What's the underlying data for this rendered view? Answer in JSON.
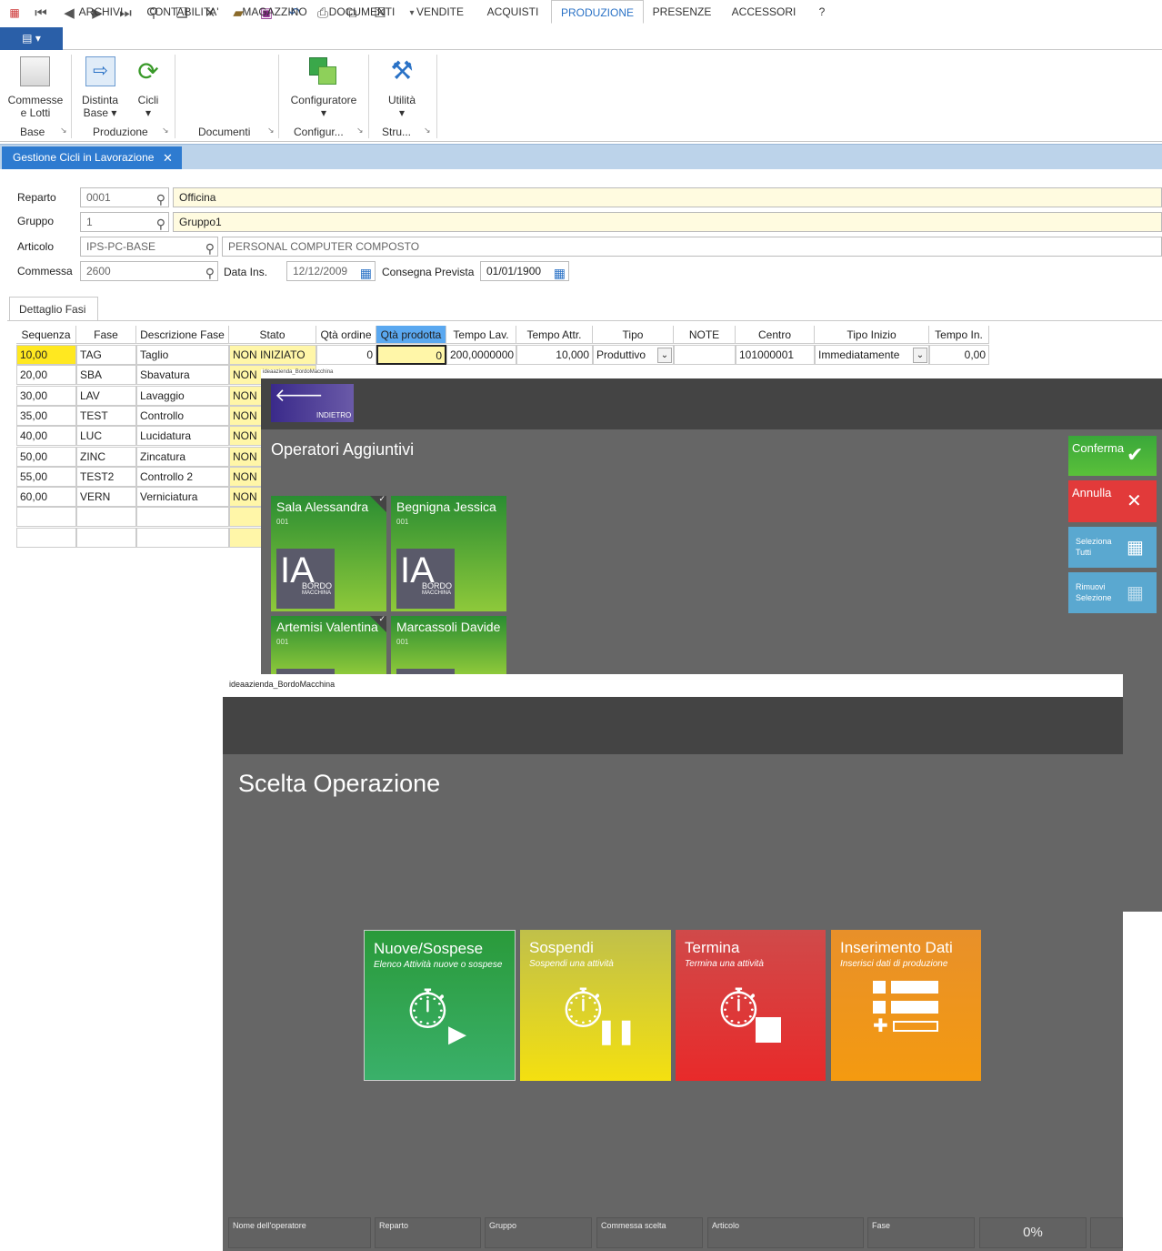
{
  "menu": {
    "file": "▤ ▾",
    "tabs": [
      "ARCHIVI",
      "CONTABILITA'",
      "MAGAZZINO",
      "DOCUMENTI",
      "VENDITE",
      "ACQUISTI",
      "PRODUZIONE",
      "PRESENZE",
      "ACCESSORI",
      "?"
    ],
    "active": "PRODUZIONE"
  },
  "ribbon": {
    "buttons": [
      "Commesse\ne Lotti",
      "Distinta\nBase ▾",
      "Cicli\n▾",
      "Configuratore\n▾",
      "Utilità\n▾"
    ],
    "groups": [
      "Base",
      "Produzione",
      "Documenti",
      "Configur...",
      "Stru..."
    ]
  },
  "doc_tab": {
    "label": "Gestione Cicli in Lavorazione",
    "close": "✕"
  },
  "form": {
    "reparto_label": "Reparto",
    "reparto_code": "0001",
    "reparto_desc": "Officina",
    "gruppo_label": "Gruppo",
    "gruppo_code": "1",
    "gruppo_desc": "Gruppo1",
    "articolo_label": "Articolo",
    "articolo_code": "IPS-PC-BASE",
    "articolo_desc": "PERSONAL COMPUTER COMPOSTO",
    "commessa_label": "Commessa",
    "commessa_code": "2600",
    "data_ins_label": "Data Ins.",
    "data_ins": "12/12/2009",
    "consegna_label": "Consegna Prevista",
    "consegna": "01/01/1900"
  },
  "dettaglio_tab": "Dettaglio Fasi",
  "grid": {
    "headers": [
      "Sequenza",
      "Fase",
      "Descrizione Fase",
      "Stato",
      "Qtà ordine",
      "Qtà prodotta",
      "Tempo Lav.",
      "Tempo Attr.",
      "Tipo",
      "NOTE",
      "Centro",
      "Tipo Inizio",
      "Tempo In."
    ],
    "rows": [
      [
        "10,00",
        "TAG",
        "Taglio",
        "NON INIZIATO",
        "0",
        "0",
        "200,0000000",
        "10,000",
        "Produttivo",
        "",
        "101000001",
        "Immediatamente",
        "0,00"
      ],
      [
        "20,00",
        "SBA",
        "Sbavatura",
        "NON"
      ],
      [
        "30,00",
        "LAV",
        "Lavaggio",
        "NON"
      ],
      [
        "35,00",
        "TEST",
        "Controllo",
        "NON"
      ],
      [
        "40,00",
        "LUC",
        "Lucidatura",
        "NON"
      ],
      [
        "50,00",
        "ZINC",
        "Zincatura",
        "NON"
      ],
      [
        "55,00",
        "TEST2",
        "Controllo 2",
        "NON"
      ],
      [
        "60,00",
        "VERN",
        "Verniciatura",
        "NON"
      ]
    ]
  },
  "overlay1": {
    "window_title": "ideaazienda_BordoMacchina",
    "back_label": "INDIETRO",
    "title": "Operatori Aggiuntivi",
    "operators": [
      {
        "name": "Sala Alessandra",
        "code": "001"
      },
      {
        "name": "Begnigna Jessica",
        "code": "001"
      },
      {
        "name": "Artemisi Valentina",
        "code": "001"
      },
      {
        "name": "Marcassoli Davide",
        "code": "001"
      }
    ],
    "logo_top": "BORDO",
    "logo_bottom": "MACCHINA",
    "conferma": "Conferma",
    "annulla": "Annulla",
    "seleziona": "Seleziona\nTutti",
    "rimuovi": "Rimuovi\nSelezione"
  },
  "overlay2": {
    "window_title": "ideaazienda_BordoMacchina",
    "title": "Scelta Operazione",
    "ops": [
      {
        "title": "Nuove/Sospese",
        "sub": "Elenco Attività nuove o sospese"
      },
      {
        "title": "Sospendi",
        "sub": "Sospendi una attività"
      },
      {
        "title": "Termina",
        "sub": "Termina una attività"
      },
      {
        "title": "Inserimento Dati",
        "sub": "Inserisci dati di produzione"
      }
    ],
    "status": [
      "Nome dell'operatore",
      "Reparto",
      "Gruppo",
      "Commessa scelta",
      "Articolo",
      "Fase"
    ],
    "progress": "0%"
  }
}
